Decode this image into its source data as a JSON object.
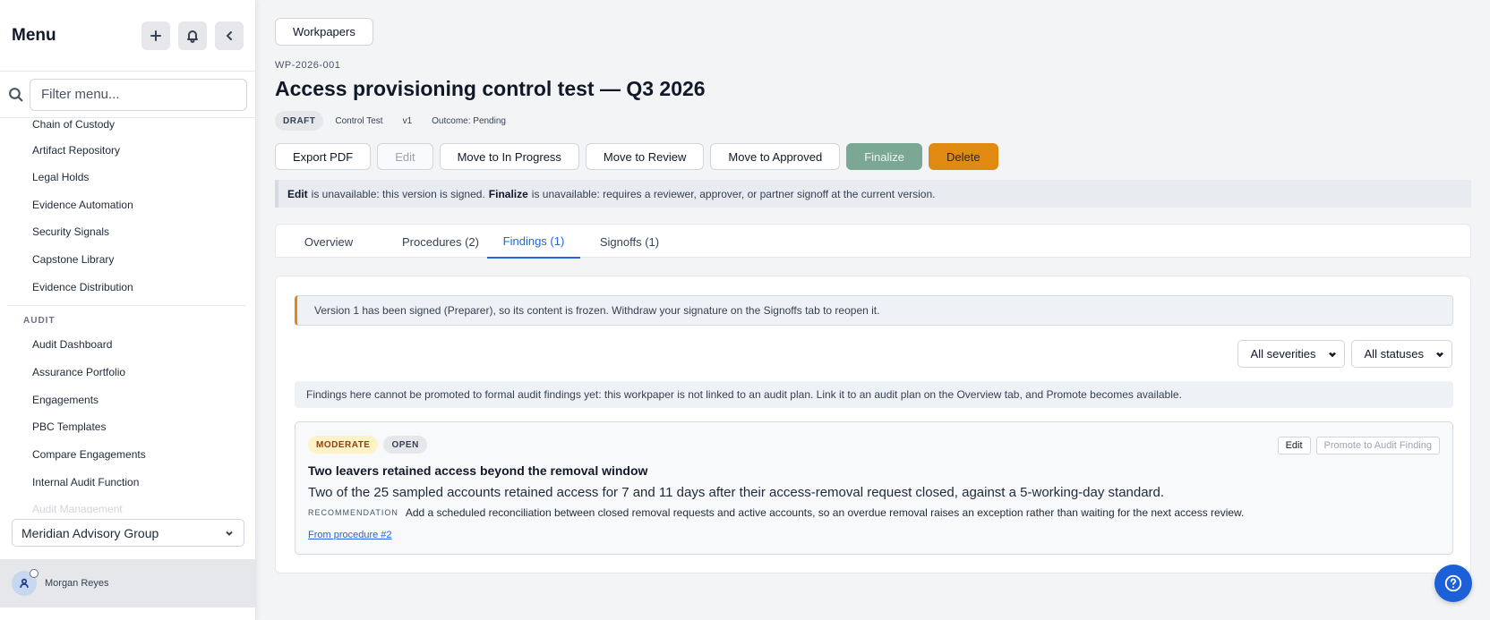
{
  "sidebar": {
    "title": "Menu",
    "search_placeholder": "Filter menu...",
    "items_top": [
      "Chain of Custody",
      "Artifact Repository",
      "Legal Holds",
      "Evidence Automation",
      "Security Signals",
      "Capstone Library",
      "Evidence Distribution"
    ],
    "section_audit": "AUDIT",
    "items_audit": [
      "Audit Dashboard",
      "Assurance Portfolio",
      "Engagements",
      "PBC Templates",
      "Compare Engagements",
      "Internal Audit Function",
      "Audit Management"
    ],
    "org": "Meridian Advisory Group",
    "user": "Morgan Reyes"
  },
  "header": {
    "crumb": "Workpapers",
    "wp_id": "WP-2026-001",
    "title": "Access provisioning control test — Q3 2026",
    "badges": [
      "DRAFT",
      "Control Test",
      "v1",
      "Outcome: Pending"
    ]
  },
  "actions": {
    "export": "Export PDF",
    "edit": "Edit",
    "in_progress": "Move to In Progress",
    "review": "Move to Review",
    "approved": "Move to Approved",
    "finalize": "Finalize",
    "delete": "Delete"
  },
  "notice": {
    "edit_b": "Edit",
    "edit_t": "is unavailable: this version is signed.",
    "fin_b": "Finalize",
    "fin_t": "is unavailable: requires a reviewer, approver, or partner signoff at the current version."
  },
  "tabs": [
    "Overview",
    "Procedures (2)",
    "Findings (1)",
    "Signoffs (1)"
  ],
  "findings": {
    "frozen_note": "Version 1 has been signed (Preparer), so its content is frozen. Withdraw your signature on the Signoffs tab to reopen it.",
    "filter_severity": "All severities",
    "filter_status": "All statuses",
    "promote_note": "Findings here cannot be promoted to formal audit findings yet: this workpaper is not linked to an audit plan. Link it to an audit plan on the Overview tab, and Promote becomes available.",
    "item": {
      "severity": "MODERATE",
      "status": "OPEN",
      "edit": "Edit",
      "promote": "Promote to Audit Finding",
      "title": "Two leavers retained access beyond the removal window",
      "description": "Two of the 25 sampled accounts retained access for 7 and 11 days after their access-removal request closed, against a 5-working-day standard.",
      "rec_label": "RECOMMENDATION",
      "recommendation": "Add a scheduled reconciliation between closed removal requests and active accounts, so an overdue removal raises an exception rather than waiting for the next access review.",
      "link": "From procedure #2"
    }
  },
  "colors": {
    "accent": "#2563eb",
    "finalize": "#7aa895",
    "delete": "#e08a12",
    "moderate_bg": "#fdf3c7"
  }
}
